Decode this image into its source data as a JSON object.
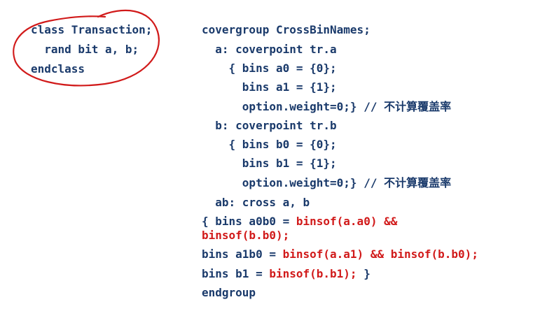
{
  "left_code": {
    "line1": "class Transaction;",
    "line2": "  rand bit a, b;",
    "line3": "endclass"
  },
  "right_code": {
    "line1": "covergroup CrossBinNames;",
    "line2": "  a: coverpoint tr.a",
    "line3": "    { bins a0 = {0};",
    "line4": "      bins a1 = {1};",
    "line5_code": "      option.weight=0;} // ",
    "line5_comment": "不计算覆盖率",
    "line6": "  b: coverpoint tr.b",
    "line7": "    { bins b0 = {0};",
    "line8": "      bins b1 = {1};",
    "line9_code": "      option.weight=0;} // ",
    "line9_comment": "不计算覆盖率",
    "line10": "  ab: cross a, b",
    "line11_a": "{ bins a0b0 = ",
    "line11_b": "binsof(a.a0) &&",
    "line12": "binsof(b.b0);",
    "line13_a": "bins a1b0 = ",
    "line13_b": "binsof(a.a1) && binsof(b.b0);",
    "line14_a": "bins b1 = ",
    "line14_b": "binsof(b.b1);",
    "line14_c": " }",
    "line15": "endgroup"
  },
  "colors": {
    "code": "#1a3a6b",
    "highlight": "#d11a1a",
    "annotation": "#d11a1a"
  }
}
